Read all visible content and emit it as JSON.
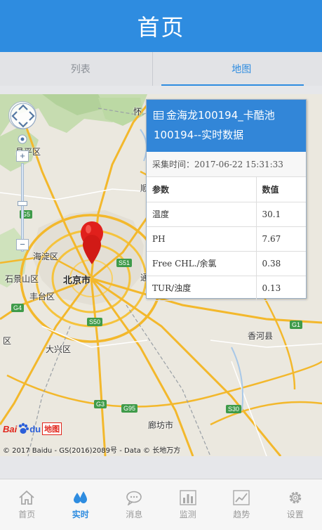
{
  "header": {
    "title": "首页"
  },
  "tabs": [
    {
      "label": "列表"
    },
    {
      "label": "地图"
    }
  ],
  "map": {
    "labels": {
      "huairou": "怀",
      "changping": "昌平区",
      "shun": "顺",
      "haidian": "海淀区",
      "shijingshan": "石景山区",
      "beijing": "北京市",
      "fengtai": "丰台区",
      "daxing": "大兴区",
      "langfang": "廊坊市",
      "xianghe": "香河县",
      "tong": "通",
      "qu": "区"
    },
    "shields": {
      "s51": "S51",
      "s50": "S50",
      "g4": "G4",
      "g3": "G3",
      "g95": "G95",
      "s30": "S30",
      "g1": "G1",
      "g5": "G5"
    },
    "logo": {
      "part1": "Bai",
      "part2": "du",
      "part3": "地图"
    },
    "copyright": "© 2017 Baidu - GS(2016)2089号 - Data © 长地万方"
  },
  "info": {
    "title_line1": "金海龙100194_卡酷池",
    "title_line2": "100194--实时数据",
    "time_label": "采集时间：",
    "time_value": "2017-06-22 15:31:33",
    "columns": [
      "参数",
      "数值"
    ],
    "rows": [
      {
        "param": "温度",
        "value": "30.1"
      },
      {
        "param": "PH",
        "value": "7.67"
      },
      {
        "param": "Free CHL./余氯",
        "value": "0.38"
      },
      {
        "param": "TUR/浊度",
        "value": "0.13"
      }
    ]
  },
  "tabbar": [
    {
      "label": "首页",
      "icon": "home-icon"
    },
    {
      "label": "实时",
      "icon": "water-drops-icon"
    },
    {
      "label": "消息",
      "icon": "chat-icon"
    },
    {
      "label": "监测",
      "icon": "bar-chart-icon"
    },
    {
      "label": "趋势",
      "icon": "trend-icon"
    },
    {
      "label": "设置",
      "icon": "gear-icon"
    }
  ],
  "colors": {
    "primary": "#2e8ce0",
    "road_yellow": "#f5c33d",
    "green_area": "#b9d7a3"
  }
}
